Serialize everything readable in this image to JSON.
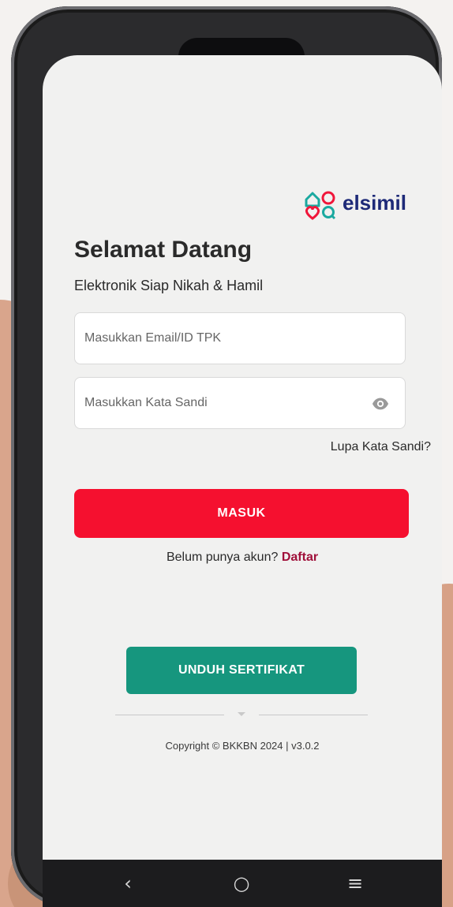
{
  "brand": {
    "logo_text": "elsimil",
    "colors": {
      "teal": "#1aa9a0",
      "red": "#f0163a",
      "navy": "#1e2a78"
    }
  },
  "welcome": {
    "title": "Selamat Datang",
    "subtitle": "Elektronik Siap Nikah & Hamil"
  },
  "form": {
    "email_placeholder": "Masukkan Email/ID TPK",
    "password_placeholder": "Masukkan Kata Sandi",
    "password_toggle_icon": "eye-icon",
    "forgot_label": "Lupa Kata Sandi?",
    "login_label": "MASUK",
    "login_color": "#f5102f"
  },
  "register": {
    "prompt": "Belum punya akun?",
    "link_label": "Daftar"
  },
  "certificate": {
    "label": "UNDUH SERTIFIKAT",
    "color": "#16967e"
  },
  "footer": {
    "copyright": "Copyright © BKKBN 2024 | v3.0.2"
  },
  "navbar": {
    "back_icon": "‹",
    "home_icon": "○",
    "menu_icon": "≡"
  }
}
